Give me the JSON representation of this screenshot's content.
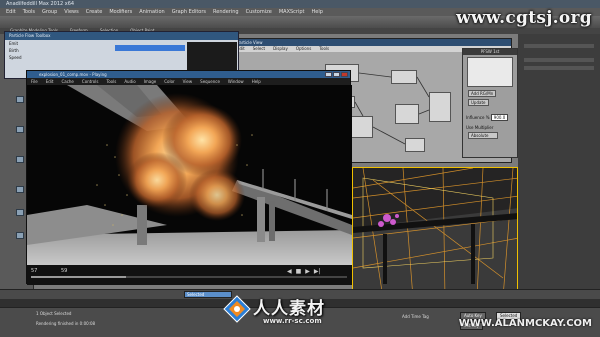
{
  "app": {
    "title": "Anadilfeddill Max 2012 x64",
    "menus": [
      "Edit",
      "Tools",
      "Group",
      "Views",
      "Create",
      "Modifiers",
      "Animation",
      "Graph Editors",
      "Rendering",
      "Customize",
      "MAXScript",
      "Help"
    ],
    "ribbon_tabs": [
      "Graphite Modeling Tools",
      "Freeform",
      "Selection",
      "Object Paint"
    ]
  },
  "watermark": {
    "top": "www.cgtsj.org",
    "logo_cn": "人人素材",
    "logo_url": "www.rr-sc.com",
    "author": "WWW.ALANMCKAY.COM"
  },
  "tool_window": {
    "title": "Particle Flow Toolbox",
    "rows": [
      "Emit",
      "Birth",
      "Speed",
      "Shape"
    ]
  },
  "slate": {
    "title": "Particle View",
    "menus": [
      "Edit",
      "Select",
      "Display",
      "Options",
      "Tools"
    ]
  },
  "params": {
    "header": "PFSW 1st",
    "labels": [
      "Add RG/Mn",
      "Update",
      "Influence %",
      "Use Multiplier"
    ],
    "influence_value": "900.0",
    "dropdown": "Absolute"
  },
  "player": {
    "title": "explosion_01_comp.mov - Playing",
    "menus": [
      "File",
      "Edit",
      "Cache",
      "Controls",
      "Tools",
      "Audio",
      "Image",
      "Color",
      "View",
      "Sequence",
      "Window",
      "Help"
    ],
    "frame_current": "57",
    "frame_end": "59"
  },
  "status": {
    "line1": "1 Object Selected",
    "line2": "Rendering finished in 0:00:08",
    "coord": "Add Time Tag",
    "buttons": [
      "Auto Key",
      "Set Key",
      "Selected"
    ]
  },
  "timeline": {
    "selected_label": "Selected"
  }
}
